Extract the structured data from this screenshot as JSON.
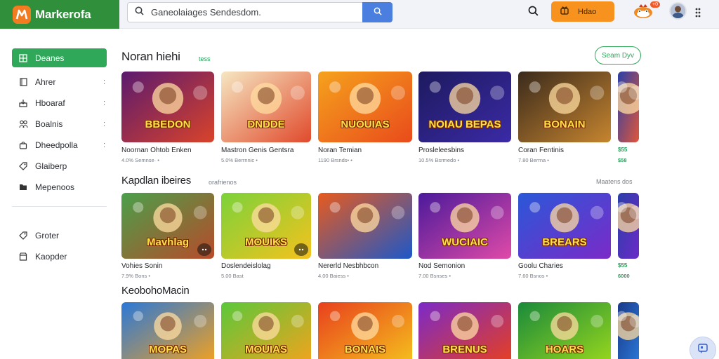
{
  "brand": {
    "name": "Markerofa",
    "logo_icon": "game-logo-icon",
    "color": "#2f8f3a"
  },
  "search": {
    "placeholder": "",
    "value": "Ganeolaiages Sendesdom."
  },
  "header": {
    "promo_label": "Hdao",
    "mascot_badge": "+0"
  },
  "sidebar": {
    "items": [
      {
        "label": "Deanes",
        "icon": "grid-icon",
        "active": true
      },
      {
        "label": "Ahrer",
        "icon": "doc-icon",
        "chevron": ":"
      },
      {
        "label": "Hboaraf",
        "icon": "download-icon",
        "chevron": ":"
      },
      {
        "label": "Boalnis",
        "icon": "people-icon",
        "chevron": ":"
      },
      {
        "label": "Dheedpolla",
        "icon": "bag-icon",
        "chevron": ":"
      },
      {
        "label": "Glaiberp",
        "icon": "tag-icon"
      },
      {
        "label": "Mepenoos",
        "icon": "folder-icon"
      }
    ],
    "lower_items": [
      {
        "label": "Groter",
        "icon": "tag-icon"
      },
      {
        "label": "Kaopder",
        "icon": "store-icon"
      }
    ]
  },
  "sections": [
    {
      "title": "Noran hiehi",
      "subtitle": "tess",
      "action": "Seam Dyv",
      "cards": [
        {
          "title": "Noornan Ohtob Enken",
          "meta": "4.0% Semnse· •"
        },
        {
          "title": "Mastron Genis Gentsra",
          "meta": "5.0% Berrnnic •"
        },
        {
          "title": "Noran Temian",
          "meta": "1190 Brsnds• •"
        },
        {
          "title": "Prosleleesbins",
          "meta": "10.5% Bsrmedo •"
        },
        {
          "title": "Coran Fentinis",
          "meta": "7.80 Berrna •"
        },
        {
          "title": "$55",
          "meta": "$58"
        }
      ]
    },
    {
      "title": "Kapdlan ibeires",
      "subtitle": "orafrienos",
      "action": "Maatens dos",
      "cards": [
        {
          "title": "Vohies Sonin",
          "meta": "7.9% Bons •"
        },
        {
          "title": "Doslendeislolag",
          "meta": "5.00 Bast"
        },
        {
          "title": "Nererld Nesbhbcon",
          "meta": "4.00 Baiess •"
        },
        {
          "title": "Nod Semonion",
          "meta": "7.00 Bsnses •"
        },
        {
          "title": "Goolu Charies",
          "meta": "7.60 Bsnos •"
        },
        {
          "title": "$55",
          "meta": "6000"
        }
      ]
    },
    {
      "title": "KeobohoMacin",
      "cards": [
        {
          "title": ""
        },
        {
          "title": ""
        },
        {
          "title": ""
        },
        {
          "title": ""
        },
        {
          "title": ""
        },
        {
          "title": ""
        }
      ]
    }
  ],
  "thumb_art": {
    "row1": [
      "BBEDON",
      "DNDDE",
      "NUOUIAS",
      "NOIAU BEPAS",
      "BONAIN",
      ""
    ],
    "row2": [
      "Mavhlag",
      "MOUIKS",
      "",
      "WUCIAIC",
      "BREARS",
      ""
    ],
    "row3": [
      "MOPAS",
      "MOUIAS",
      "BONAIS",
      "BRENUS",
      "HOARS",
      ""
    ]
  },
  "colors": {
    "accent_green": "#2fa85a",
    "search_blue": "#4a7fe0",
    "promo_orange": "#f7921e"
  }
}
